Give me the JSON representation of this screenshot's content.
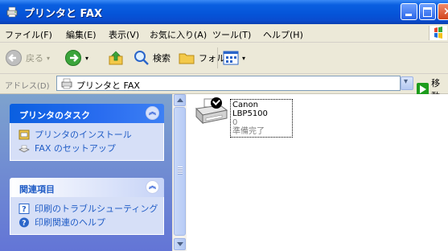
{
  "window": {
    "title": "プリンタと FAX"
  },
  "menubar": {
    "items": [
      "ファイル(F)",
      "編集(E)",
      "表示(V)",
      "お気に入り(A)",
      "ツール(T)",
      "ヘルプ(H)"
    ]
  },
  "toolbar": {
    "back_label": "戻る",
    "search_label": "検索",
    "folders_label": "フォルダ"
  },
  "address": {
    "label": "アドレス(D)",
    "value": "プリンタと FAX",
    "go_label": "移動"
  },
  "tasks": {
    "printer_tasks": {
      "title": "プリンタのタスク",
      "items": [
        "プリンタのインストール",
        "FAX のセットアップ"
      ]
    },
    "related": {
      "title": "関連項目",
      "items": [
        "印刷のトラブルシューティング",
        "印刷関連のヘルプ"
      ]
    }
  },
  "printer": {
    "name": "Canon LBP5100",
    "count": "0",
    "status": "準備完了"
  },
  "colors": {
    "titlebar": "#0554d8",
    "task_link": "#215dc6",
    "pane_background": "#6375d6"
  }
}
